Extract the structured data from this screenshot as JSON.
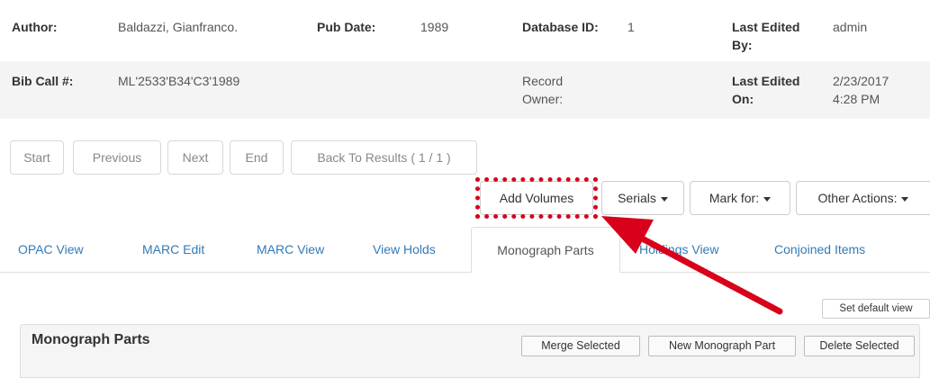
{
  "record": {
    "author_label": "Author:",
    "author_value": "Baldazzi, Gianfranco.",
    "pubdate_label": "Pub Date:",
    "pubdate_value": "1989",
    "dbid_label": "Database ID:",
    "dbid_value": "1",
    "last_edited_by_label_1": "Last Edited",
    "last_edited_by_label_2": "By:",
    "last_edited_by_value": "admin",
    "bibcall_label": "Bib Call #:",
    "bibcall_value": "ML'2533'B34'C3'1989",
    "record_owner_label_1": "Record",
    "record_owner_label_2": "Owner:",
    "last_edited_on_label_1": "Last Edited",
    "last_edited_on_label_2": "On:",
    "last_edited_on_date": "2/23/2017",
    "last_edited_on_time": "4:28 PM"
  },
  "pager": {
    "start": "Start",
    "previous": "Previous",
    "next": "Next",
    "end": "End",
    "back_to_results": "Back To Results ( 1 / 1 )"
  },
  "actions": {
    "add_volumes": "Add Volumes",
    "serials": "Serials",
    "mark_for": "Mark for:",
    "other_actions": "Other Actions:"
  },
  "tabs": [
    {
      "label": "OPAC View"
    },
    {
      "label": "MARC Edit"
    },
    {
      "label": "MARC View"
    },
    {
      "label": "View Holds"
    },
    {
      "label": "Monograph Parts",
      "active": true
    },
    {
      "label": "Holdings View"
    },
    {
      "label": "Conjoined Items"
    }
  ],
  "set_default_view": "Set default view",
  "panel": {
    "title": "Monograph Parts",
    "merge_selected": "Merge Selected",
    "new_monograph_part": "New Monograph Part",
    "delete_selected": "Delete Selected"
  },
  "annotation": {
    "highlight_color": "#d9001b",
    "arrow_color": "#d9001b"
  }
}
